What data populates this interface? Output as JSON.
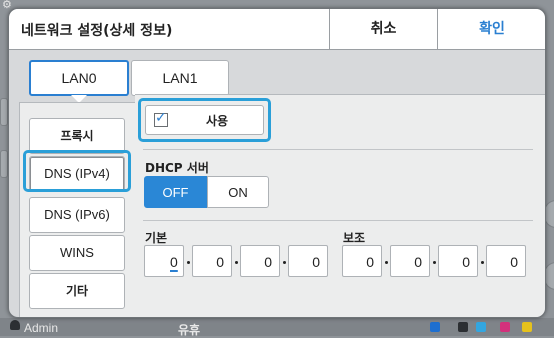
{
  "dialog": {
    "title": "네트워크 설정(상세 정보)",
    "cancel_label": "취소",
    "confirm_label": "확인"
  },
  "lan_tabs": [
    {
      "label": "LAN0",
      "selected": true
    },
    {
      "label": "LAN1",
      "selected": false
    }
  ],
  "nav": {
    "items": [
      {
        "label": "프록시"
      },
      {
        "label": "DNS (IPv4)",
        "selected": true
      },
      {
        "label": "DNS (IPv6)"
      },
      {
        "label": "WINS"
      },
      {
        "label": "기타"
      }
    ]
  },
  "use": {
    "label": "사용",
    "checked": true
  },
  "dhcp": {
    "label": "DHCP 서버",
    "off_label": "OFF",
    "on_label": "ON",
    "selected": "OFF"
  },
  "primary": {
    "label": "기본",
    "octets": [
      "0",
      "0",
      "0",
      "0"
    ]
  },
  "secondary": {
    "label": "보조",
    "octets": [
      "0",
      "0",
      "0",
      "0"
    ]
  },
  "footer": {
    "user": "Admin",
    "status_text": "유휴"
  },
  "colors": {
    "accent": "#2a7fd1",
    "highlight": "#2a9fd8"
  }
}
